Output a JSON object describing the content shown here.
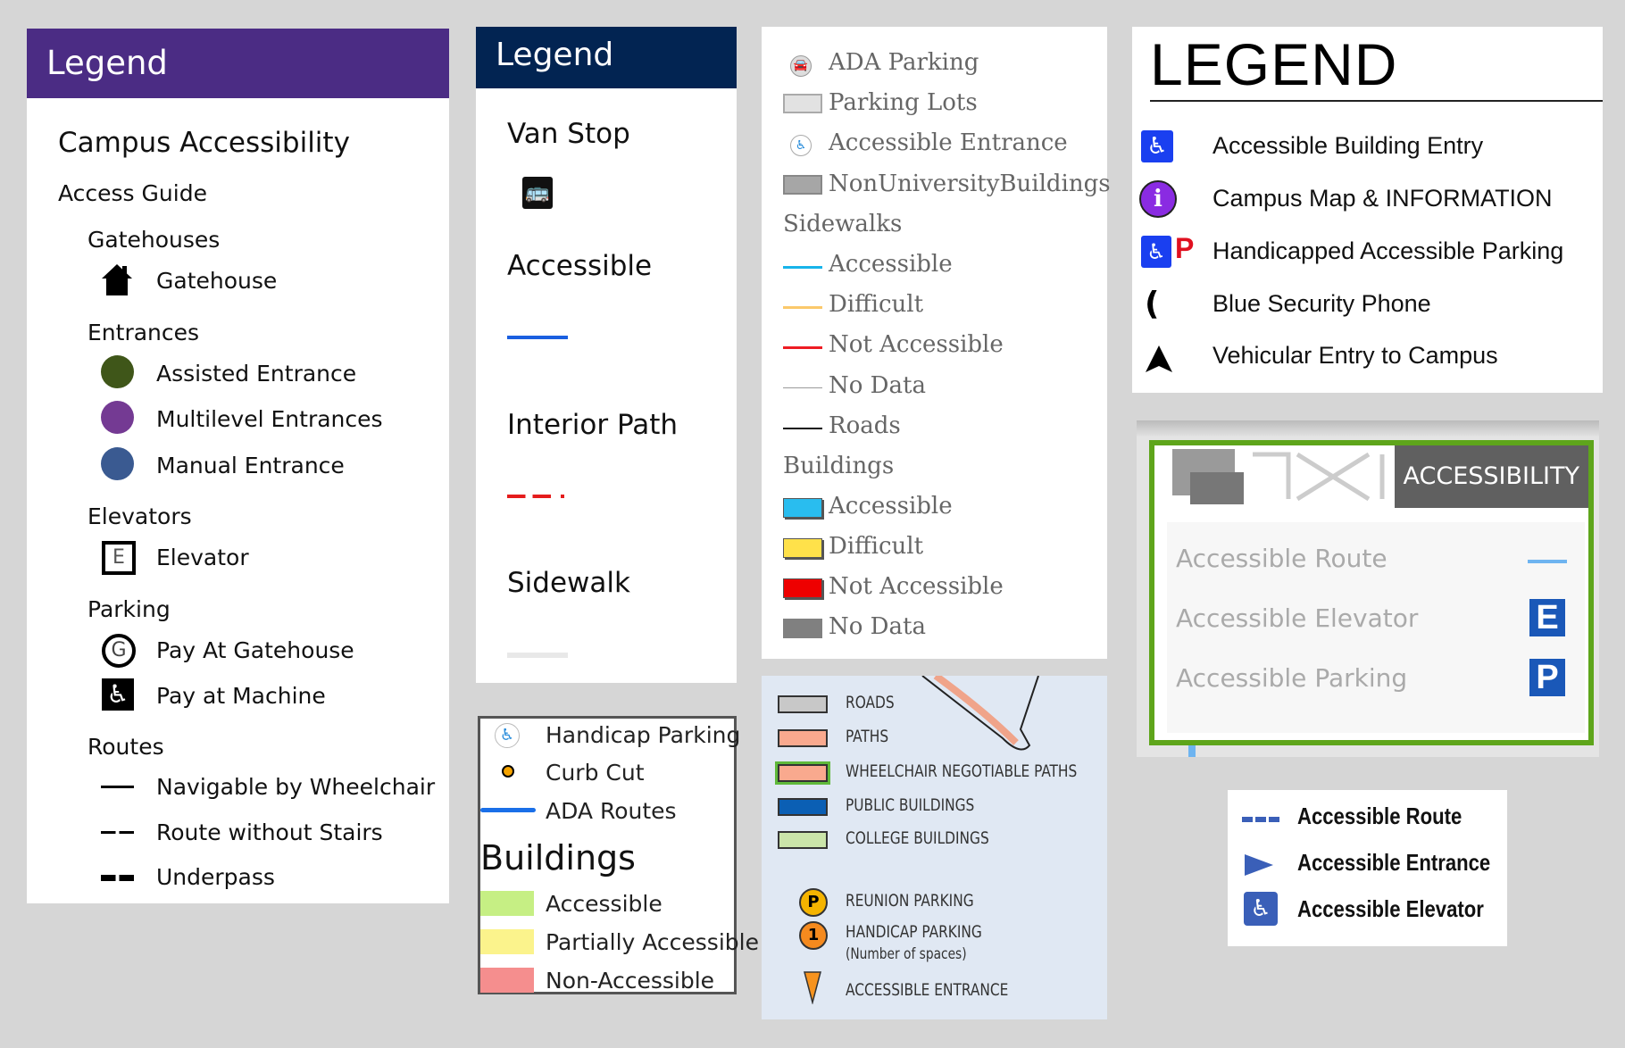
{
  "panel1": {
    "header": "Legend",
    "title": "Campus Accessibility",
    "subtitle": "Access Guide",
    "header_color": "#4b2c84",
    "sections": [
      {
        "heading": "Gatehouses",
        "items": [
          {
            "icon": "house-icon",
            "label": "Gatehouse"
          }
        ]
      },
      {
        "heading": "Entrances",
        "items": [
          {
            "icon": "circle-icon",
            "color": "#3f5619",
            "label": "Assisted Entrance"
          },
          {
            "icon": "circle-icon",
            "color": "#743a93",
            "label": "Multilevel Entrances"
          },
          {
            "icon": "circle-icon",
            "color": "#3a5a91",
            "label": "Manual Entrance"
          }
        ]
      },
      {
        "heading": "Elevators",
        "items": [
          {
            "icon": "elevator-icon",
            "glyph": "E",
            "label": "Elevator"
          }
        ]
      },
      {
        "heading": "Parking",
        "items": [
          {
            "icon": "gatehouse-pay-icon",
            "glyph": "G",
            "label": "Pay At Gatehouse"
          },
          {
            "icon": "wheelchair-icon",
            "label": "Pay at Machine"
          }
        ]
      },
      {
        "heading": "Routes",
        "items": [
          {
            "icon": "solid-line-icon",
            "label": "Navigable by Wheelchair"
          },
          {
            "icon": "dashed-line-icon",
            "label": "Route without Stairs"
          },
          {
            "icon": "thick-dashed-line-icon",
            "label": "Underpass"
          }
        ]
      }
    ]
  },
  "panel2": {
    "header": "Legend",
    "header_color": "#022452",
    "items": [
      {
        "label": "Van Stop",
        "icon": "bus-icon"
      },
      {
        "label": "Accessible",
        "icon": "blue-line-icon",
        "color": "#1a5fe0"
      },
      {
        "label": "Interior Path",
        "icon": "red-dashed-line-icon",
        "color": "#e51c1c"
      },
      {
        "label": "Sidewalk",
        "icon": "gray-line-icon",
        "color": "#e8e8e8"
      }
    ]
  },
  "panel3": {
    "items": [
      {
        "label": "Handicap Parking",
        "icon": "wheelchair-icon"
      },
      {
        "label": "Curb Cut",
        "icon": "orange-dot-icon",
        "color": "#f5a300"
      },
      {
        "label": "ADA Routes",
        "icon": "blue-line-icon",
        "color": "#1a6fe8"
      }
    ],
    "buildings_heading": "Buildings",
    "buildings": [
      {
        "label": "Accessible",
        "color": "#c6ef84"
      },
      {
        "label": "Partially Accessible",
        "color": "#fbf38c"
      },
      {
        "label": "Non-Accessible",
        "color": "#f58e8e"
      }
    ]
  },
  "panel4": {
    "top_items": [
      {
        "label": "ADA Parking",
        "icon": "car-icon"
      },
      {
        "label": "Parking Lots",
        "icon": "swatch",
        "color": "#e2e2e2"
      },
      {
        "label": "Accessible Entrance",
        "icon": "wheelchair-icon"
      },
      {
        "label": "NonUniversityBuildings",
        "icon": "swatch",
        "color": "#a6a6a6"
      }
    ],
    "sidewalks_heading": "Sidewalks",
    "sidewalks": [
      {
        "label": "Accessible",
        "color": "#17b4ea"
      },
      {
        "label": "Difficult",
        "color": "#fbc96b"
      },
      {
        "label": "Not Accessible",
        "color": "#ee1c24"
      },
      {
        "label": "No Data",
        "color": "#9a9a9a"
      },
      {
        "label": "Roads",
        "color": "#111111"
      }
    ],
    "buildings_heading": "Buildings",
    "buildings": [
      {
        "label": "Accessible",
        "color": "#29bdef"
      },
      {
        "label": "Difficult",
        "color": "#ffe14a"
      },
      {
        "label": "Not Accessible",
        "color": "#ee0000"
      },
      {
        "label": "No Data",
        "color": "#808080"
      }
    ]
  },
  "panel5": {
    "items": [
      {
        "label": "ROADS",
        "color": "#c8c8c8"
      },
      {
        "label": "PATHS",
        "color": "#f9a98e"
      },
      {
        "label": "WHEELCHAIR NEGOTIABLE PATHS",
        "color": "#f9a98e",
        "outline": "#5fb93a"
      },
      {
        "label": "PUBLIC BUILDINGS",
        "color": "#0b5fb4"
      },
      {
        "label": "COLLEGE BUILDINGS",
        "color": "#cbe5a9"
      }
    ],
    "markers": [
      {
        "label": "REUNION PARKING",
        "glyph": "P",
        "icon": "parking-marker-icon"
      },
      {
        "label": "HANDICAP PARKING",
        "sublabel": "(Number of spaces)",
        "glyph": "1",
        "icon": "handicap-count-icon"
      },
      {
        "label": "ACCESSIBLE ENTRANCE",
        "icon": "orange-pin-icon"
      }
    ]
  },
  "panel6": {
    "title": "LEGEND",
    "items": [
      {
        "label": "Accessible Building Entry",
        "icon": "wheelchair-icon"
      },
      {
        "label": "Campus Map & INFORMATION",
        "icon": "info-icon",
        "glyph": "i"
      },
      {
        "label": "Handicapped Accessible Parking",
        "icon": "wheelchair-parking-icon",
        "glyph": "P"
      },
      {
        "label": "Blue Security Phone",
        "icon": "phone-icon"
      },
      {
        "label": "Vehicular Entry to Campus",
        "icon": "arrow-up-icon"
      }
    ]
  },
  "panel7": {
    "tab": "ACCESSIBILITY",
    "items": [
      {
        "label": "Accessible Route",
        "icon": "route-line-icon"
      },
      {
        "label": "Accessible Elevator",
        "icon": "elevator-icon",
        "glyph": "E"
      },
      {
        "label": "Accessible Parking",
        "icon": "parking-icon",
        "glyph": "P"
      }
    ],
    "border_color": "#5ea51b"
  },
  "panel8": {
    "items": [
      {
        "label": "Accessible Route",
        "icon": "dashed-route-icon"
      },
      {
        "label": "Accessible Entrance",
        "icon": "triangle-right-icon"
      },
      {
        "label": "Accessible Elevator",
        "icon": "wheelchair-icon"
      }
    ],
    "accent": "#3a5fb8"
  }
}
